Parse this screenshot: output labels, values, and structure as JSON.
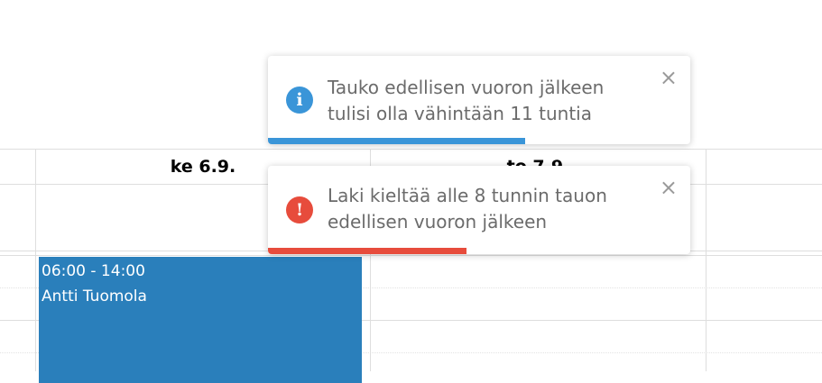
{
  "calendar": {
    "days": [
      {
        "label": "ke 6.9."
      },
      {
        "label": "to 7.9."
      }
    ],
    "event": {
      "time": "06:00 - 14:00",
      "name": "Antti Tuomola",
      "color": "#2a7fbb"
    }
  },
  "toasts": [
    {
      "type": "info",
      "icon": "info-icon",
      "icon_glyph": "i",
      "message": "Tauko edellisen vuoron jälkeen tulisi olla vähintään 11 tuntia",
      "close_label": "×",
      "progress_fraction": 0.61,
      "accent_color": "#3a95d8"
    },
    {
      "type": "error",
      "icon": "exclamation-icon",
      "icon_glyph": "!",
      "message": "Laki kieltää alle 8 tunnin tauon edellisen vuoron jälkeen",
      "close_label": "×",
      "progress_fraction": 0.47,
      "accent_color": "#e74c3c"
    }
  ]
}
